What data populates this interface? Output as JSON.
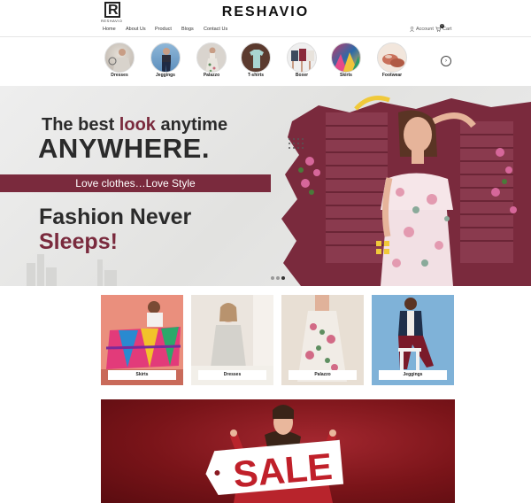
{
  "header": {
    "logo_letter": "R",
    "logo_sub": "RESHAVIO",
    "brand": "RESHAVIO",
    "nav": [
      "Home",
      "About Us",
      "Product",
      "Blogs",
      "Contact Us"
    ],
    "account_label": "Account",
    "cart_label": "Cart",
    "cart_count": "0"
  },
  "categories": [
    "Dresses",
    "Jeggings",
    "Palazzo",
    "T-shirts",
    "Boxer",
    "Skirts",
    "Footwear"
  ],
  "hero": {
    "line1_prefix": "The best ",
    "line1_accent": "look",
    "line1_suffix": " anytime",
    "line2": "ANYWHERE.",
    "ribbon": "Love clothes…Love Style",
    "line3": "Fashion Never",
    "line4": "Sleeps!"
  },
  "products": [
    "Skirts",
    "Dresses",
    "Palazzo",
    "Jeggings"
  ],
  "sale": {
    "sign": "SALE"
  },
  "colors": {
    "accent": "#7a2a3d",
    "sale_red": "#a3272f"
  }
}
